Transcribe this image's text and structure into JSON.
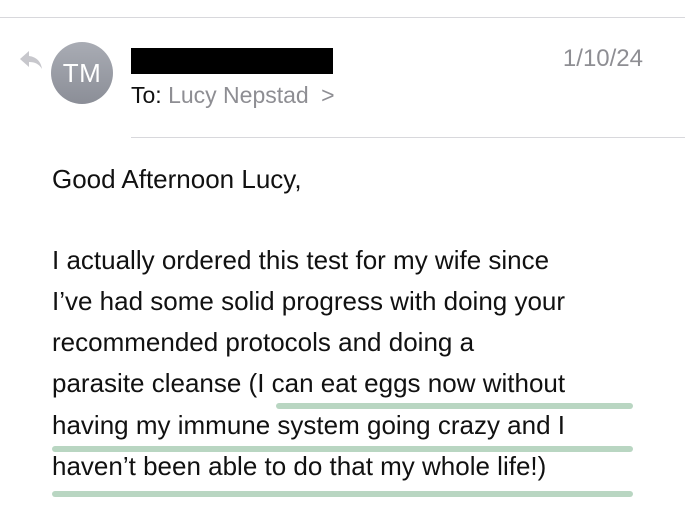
{
  "header": {
    "avatar_initials": "TM",
    "date": "1/10/24",
    "to_label": "To:",
    "recipient": "Lucy Nepstad",
    "recipient_chevron": ">"
  },
  "message": {
    "greeting": "Good Afternoon Lucy,",
    "lines": [
      "I actually ordered this test for my wife since",
      "I’ve had some solid progress with doing your",
      "recommended protocols and doing a",
      "parasite cleanse (I can eat eggs now without",
      "having my immune system going crazy and I",
      "haven’t been able to do that my whole life!)"
    ]
  },
  "colors": {
    "highlight": "#b9d6c2",
    "secondary_text": "#8e8e93",
    "avatar": "#9a9da6"
  },
  "icons": {
    "reply": "reply-arrow-icon",
    "chevron": "chevron-right-icon"
  }
}
